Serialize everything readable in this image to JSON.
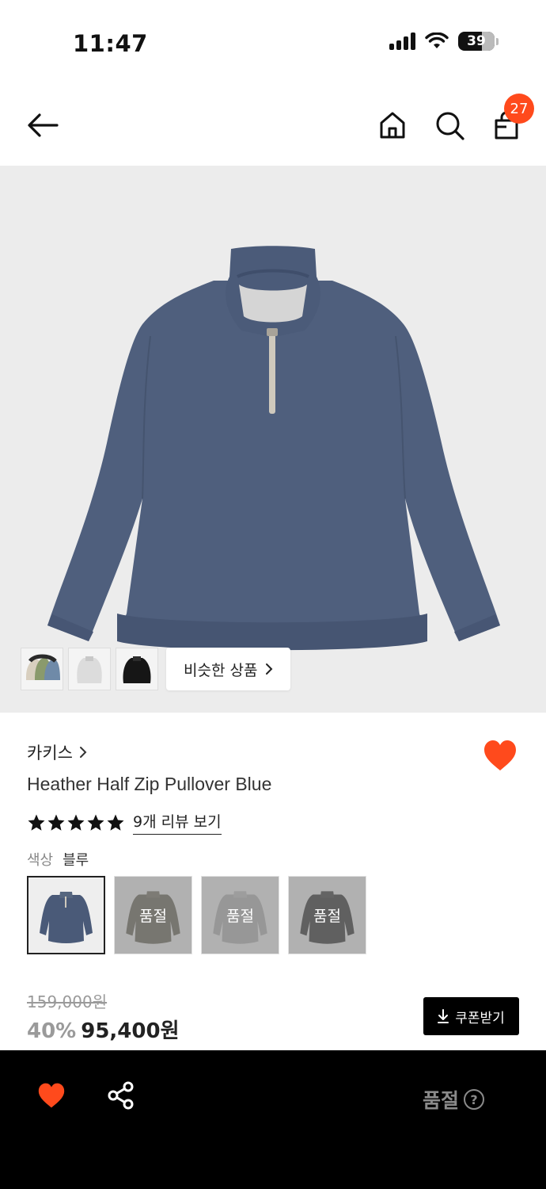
{
  "status_bar": {
    "time": "11:47",
    "battery": "39"
  },
  "nav": {
    "cart_count": "27"
  },
  "gallery": {
    "similar_label": "비슷한 상품"
  },
  "product": {
    "brand": "카키스",
    "name": "Heather Half Zip Pullover Blue",
    "rating_stars": 5,
    "review_link": "9개 리뷰 보기",
    "color_label": "색상",
    "color_value": "블루",
    "swatches": [
      {
        "color": "#4a5a78",
        "soldout": ""
      },
      {
        "color": "#6e6a5d",
        "soldout": "품절"
      },
      {
        "color": "#a9a9a9",
        "soldout": "품절"
      },
      {
        "color": "#3d3d3d",
        "soldout": "품절"
      }
    ],
    "original_price": "159,000원",
    "discount": "40%",
    "sale_price": "95,400원",
    "coupon_label": "쿠폰받기"
  },
  "bottom_bar": {
    "soldout_label": "품절",
    "help": "?"
  },
  "colors": {
    "accent": "#ff4a1c",
    "sweater": "#4f5f7d",
    "background": "#ececec"
  }
}
